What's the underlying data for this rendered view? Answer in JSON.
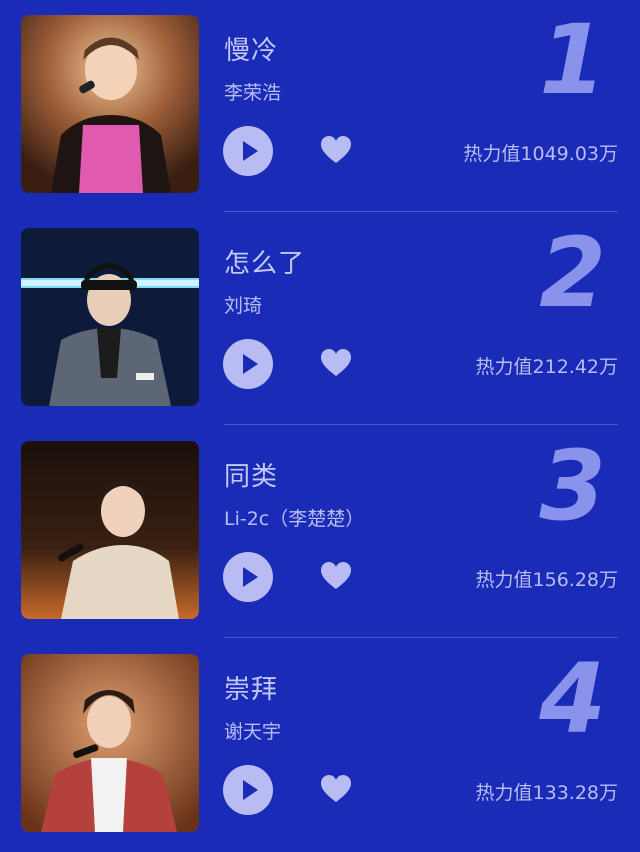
{
  "songs": [
    {
      "rank": "1",
      "title": "慢冷",
      "artist": "李荣浩",
      "heat_label": "热力值",
      "heat_value": "1049.03万"
    },
    {
      "rank": "2",
      "title": "怎么了",
      "artist": "刘琦",
      "heat_label": "热力值",
      "heat_value": "212.42万"
    },
    {
      "rank": "3",
      "title": "同类",
      "artist": "Li-2c（李楚楚）",
      "heat_label": "热力值",
      "heat_value": "156.28万"
    },
    {
      "rank": "4",
      "title": "崇拜",
      "artist": "谢天宇",
      "heat_label": "热力值",
      "heat_value": "133.28万"
    }
  ],
  "colors": {
    "background": "#1a2bb7",
    "rank_number": "#8a93ec",
    "play_button": "#b9bcf2",
    "heart": "#b9bcf2"
  },
  "icons": {
    "play": "play-icon",
    "like": "heart-icon"
  }
}
